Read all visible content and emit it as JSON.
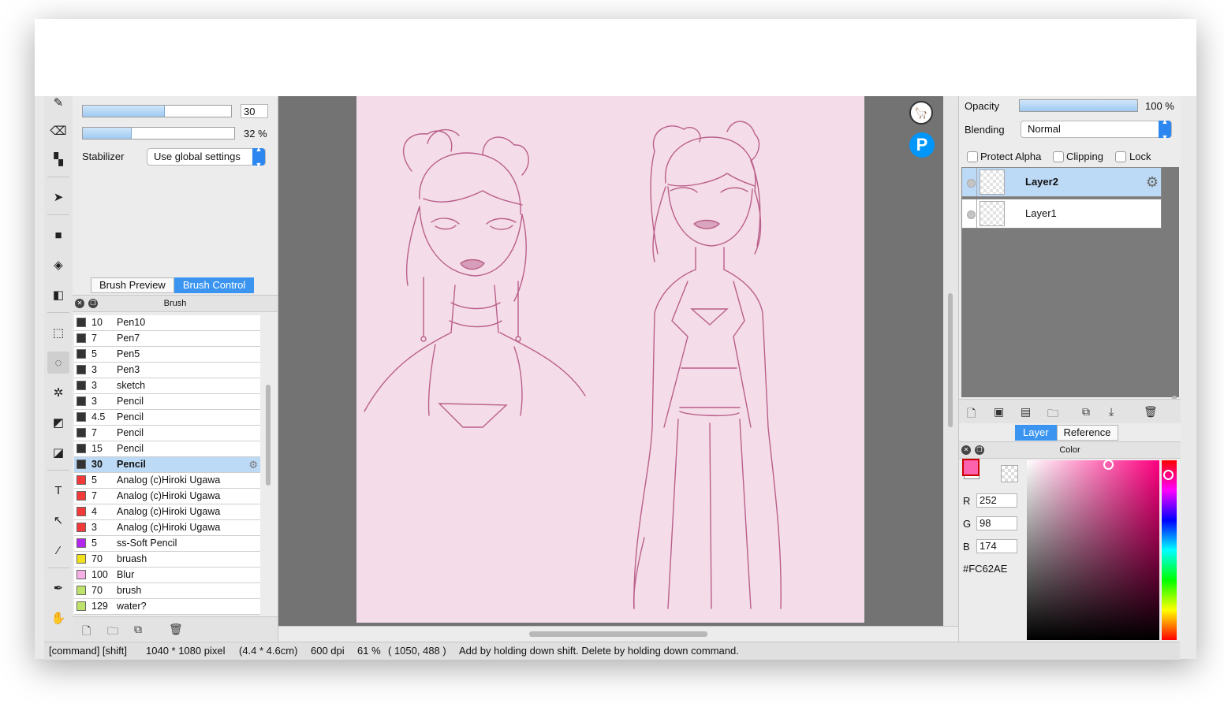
{
  "tool_panel": {
    "brush_size": {
      "value": "30",
      "fill_fraction": 0.55
    },
    "brush_density": {
      "value": "32 %",
      "fill_fraction": 0.32
    },
    "stabilizer": {
      "label": "Stabilizer",
      "value": "Use global settings"
    }
  },
  "brush_tabs": [
    {
      "label": "Brush Preview",
      "active": false
    },
    {
      "label": "Brush Control",
      "active": true
    }
  ],
  "brush_panel": {
    "title": "Brush",
    "brushes": [
      {
        "size": "10",
        "name": "Pen10",
        "color": "#333333",
        "selected": false
      },
      {
        "size": "7",
        "name": "Pen7",
        "color": "#333333",
        "selected": false
      },
      {
        "size": "5",
        "name": "Pen5",
        "color": "#333333",
        "selected": false
      },
      {
        "size": "3",
        "name": "Pen3",
        "color": "#333333",
        "selected": false
      },
      {
        "size": "3",
        "name": "sketch",
        "color": "#333333",
        "selected": false
      },
      {
        "size": "3",
        "name": "Pencil",
        "color": "#333333",
        "selected": false
      },
      {
        "size": "4.5",
        "name": "Pencil",
        "color": "#333333",
        "selected": false
      },
      {
        "size": "7",
        "name": "Pencil",
        "color": "#333333",
        "selected": false
      },
      {
        "size": "15",
        "name": "Pencil",
        "color": "#333333",
        "selected": false
      },
      {
        "size": "30",
        "name": "Pencil",
        "color": "#333333",
        "selected": true
      },
      {
        "size": "5",
        "name": "Analog (c)Hiroki Ugawa",
        "color": "#f23a3a",
        "selected": false
      },
      {
        "size": "7",
        "name": "Analog (c)Hiroki Ugawa",
        "color": "#f23a3a",
        "selected": false
      },
      {
        "size": "4",
        "name": "Analog (c)Hiroki Ugawa",
        "color": "#f23a3a",
        "selected": false
      },
      {
        "size": "3",
        "name": "Analog (c)Hiroki Ugawa",
        "color": "#f23a3a",
        "selected": false
      },
      {
        "size": "5",
        "name": "ss-Soft Pencil",
        "color": "#b226f0",
        "selected": false
      },
      {
        "size": "70",
        "name": "bruash",
        "color": "#f2e21c",
        "selected": false
      },
      {
        "size": "100",
        "name": "Blur",
        "color": "#f6b0e6",
        "selected": false
      },
      {
        "size": "70",
        "name": "brush",
        "color": "#bfe36a",
        "selected": false
      },
      {
        "size": "129",
        "name": "water?",
        "color": "#bfe36a",
        "selected": false
      }
    ]
  },
  "layer_panel": {
    "opacity_label": "Opacity",
    "opacity_value": "100 %",
    "opacity_fraction": 1.0,
    "blending_label": "Blending",
    "blending_value": "Normal",
    "protect_alpha": "Protect Alpha",
    "clipping": "Clipping",
    "lock": "Lock",
    "layers": [
      {
        "name": "Layer2",
        "selected": true
      },
      {
        "name": "Layer1",
        "selected": false
      }
    ]
  },
  "right_tabs": [
    {
      "label": "Layer",
      "active": true
    },
    {
      "label": "Reference",
      "active": false
    }
  ],
  "color_panel": {
    "title": "Color",
    "r_label": "R",
    "r": "252",
    "g_label": "G",
    "g": "98",
    "b_label": "B",
    "b": "174",
    "hex": "#FC62AE",
    "current_color": "#fc62ae"
  },
  "status_bar": {
    "modifiers": "[command] [shift]",
    "pixels": "1040 * 1080 pixel",
    "cm": "(4.4 * 4.6cm)",
    "dpi": "600 dpi",
    "zoom": "61 %",
    "coords": "( 1050, 488 )",
    "hint": "Add by holding down shift. Delete by holding down command."
  },
  "colors": {
    "accent": "#3b95f0",
    "canvas_bg": "#737373",
    "paper": "#f4dde8",
    "sketch_line": "#b04a7a"
  }
}
